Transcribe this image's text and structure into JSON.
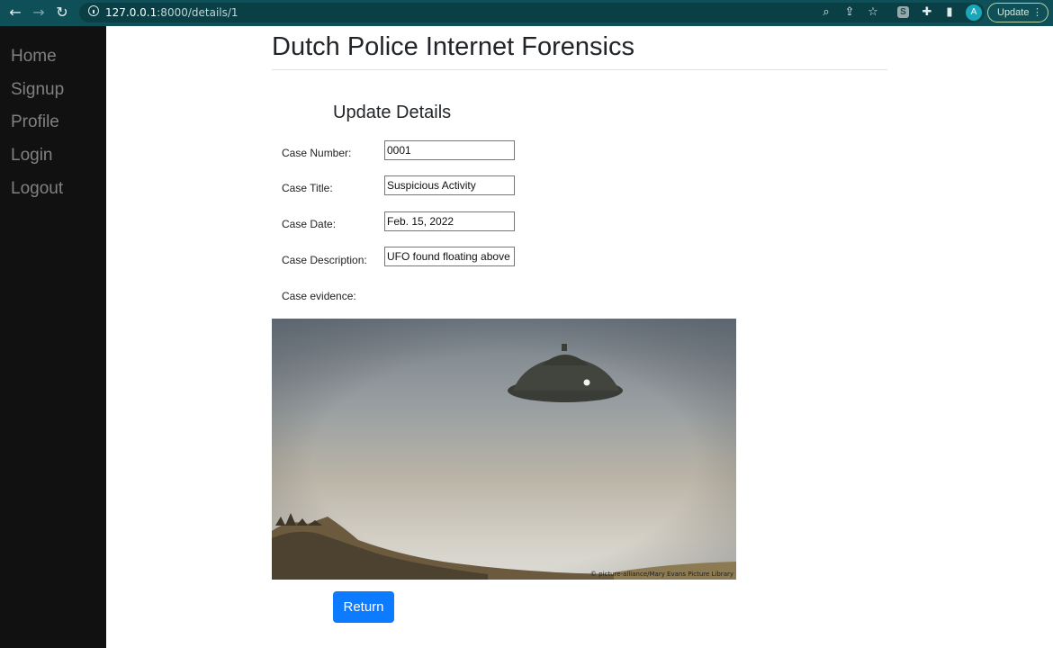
{
  "browser": {
    "url_host": "127.0.0.1",
    "url_rest": ":8000/details/1",
    "profile_initial": "A",
    "update_label": "Update",
    "extension_letter": "S"
  },
  "sidebar": {
    "items": [
      {
        "label": "Home"
      },
      {
        "label": "Signup"
      },
      {
        "label": "Profile"
      },
      {
        "label": "Login"
      },
      {
        "label": "Logout"
      }
    ]
  },
  "page": {
    "title": "Dutch Police Internet Forensics",
    "section_title": "Update Details"
  },
  "form": {
    "case_number_label": "Case Number:",
    "case_number_value": "0001",
    "case_title_label": "Case Title:",
    "case_title_value": "Suspicious Activity",
    "case_date_label": "Case Date:",
    "case_date_value": "Feb. 15, 2022",
    "case_description_label": "Case Description:",
    "case_description_value": "UFO found floating above",
    "case_evidence_label": "Case evidence:"
  },
  "evidence": {
    "credit": "© picture-alliance/Mary Evans Picture Library"
  },
  "actions": {
    "return_label": "Return"
  },
  "colors": {
    "chrome_bg": "#0f4f57",
    "sidebar_bg": "#111111",
    "sidebar_link": "#818181",
    "primary_button": "#0d7bff"
  }
}
